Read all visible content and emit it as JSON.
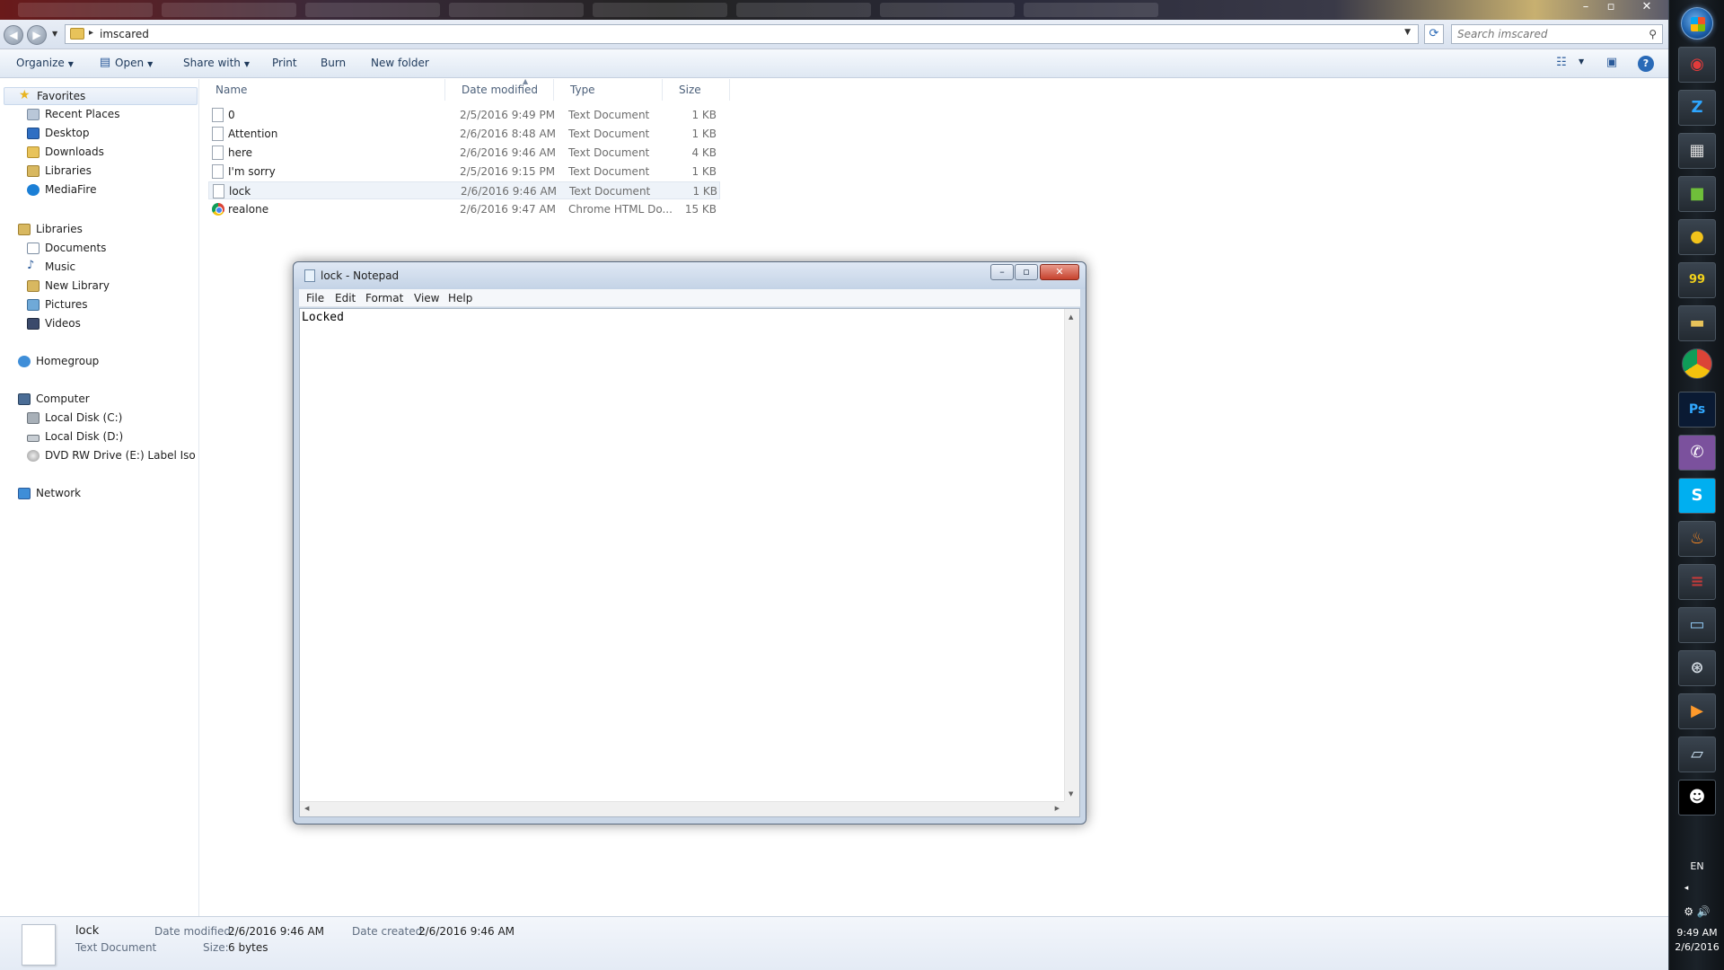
{
  "explorer": {
    "address": {
      "crumb": "imscared"
    },
    "search": {
      "placeholder": "Search imscared"
    },
    "toolbar": {
      "organize": "Organize",
      "open": "Open",
      "share_with": "Share with",
      "print": "Print",
      "burn": "Burn",
      "new_folder": "New folder"
    },
    "nav": {
      "favorites": "Favorites",
      "favorites_items": [
        "Recent Places",
        "Desktop",
        "Downloads",
        "Libraries",
        "MediaFire"
      ],
      "libraries": "Libraries",
      "libraries_items": [
        "Documents",
        "Music",
        "New Library",
        "Pictures",
        "Videos"
      ],
      "homegroup": "Homegroup",
      "computer": "Computer",
      "computer_items": [
        "Local Disk (C:)",
        "Local Disk (D:)",
        "DVD RW Drive (E:) Label Iso"
      ],
      "network": "Network"
    },
    "columns": {
      "name": "Name",
      "date": "Date modified",
      "type": "Type",
      "size": "Size"
    },
    "files": [
      {
        "name": "0",
        "date": "2/5/2016 9:49 PM",
        "type": "Text Document",
        "size": "1 KB"
      },
      {
        "name": "Attention",
        "date": "2/6/2016 8:48 AM",
        "type": "Text Document",
        "size": "1 KB"
      },
      {
        "name": "here",
        "date": "2/6/2016 9:46 AM",
        "type": "Text Document",
        "size": "4 KB"
      },
      {
        "name": "I'm sorry",
        "date": "2/5/2016 9:15 PM",
        "type": "Text Document",
        "size": "1 KB"
      },
      {
        "name": "lock",
        "date": "2/6/2016 9:46 AM",
        "type": "Text Document",
        "size": "1 KB"
      },
      {
        "name": "realone",
        "date": "2/6/2016 9:47 AM",
        "type": "Chrome HTML Do...",
        "size": "15 KB"
      }
    ],
    "details": {
      "name": "lock",
      "kind": "Text Document",
      "date_modified_label": "Date modified:",
      "date_modified": "2/6/2016 9:46 AM",
      "date_created_label": "Date created:",
      "date_created": "2/6/2016 9:46 AM",
      "size_label": "Size:",
      "size": "6 bytes"
    }
  },
  "notepad": {
    "title": "lock - Notepad",
    "menu": [
      "File",
      "Edit",
      "Format",
      "View",
      "Help"
    ],
    "content": "Locked"
  },
  "taskbar": {
    "lang": "EN",
    "time": "9:49 AM",
    "date": "2/6/2016",
    "apps": [
      "ie-icon",
      "zwift-icon",
      "film-icon",
      "minecraft-icon",
      "pacman-icon",
      "folder-99-icon",
      "file-explorer-icon",
      "chrome-icon",
      "photoshop-icon",
      "viber-icon",
      "skype-icon",
      "fire-icon",
      "winrar-icon",
      "photo-viewer-icon",
      "steam-icon",
      "media-player-icon",
      "notepad-icon",
      "skull-icon"
    ]
  }
}
